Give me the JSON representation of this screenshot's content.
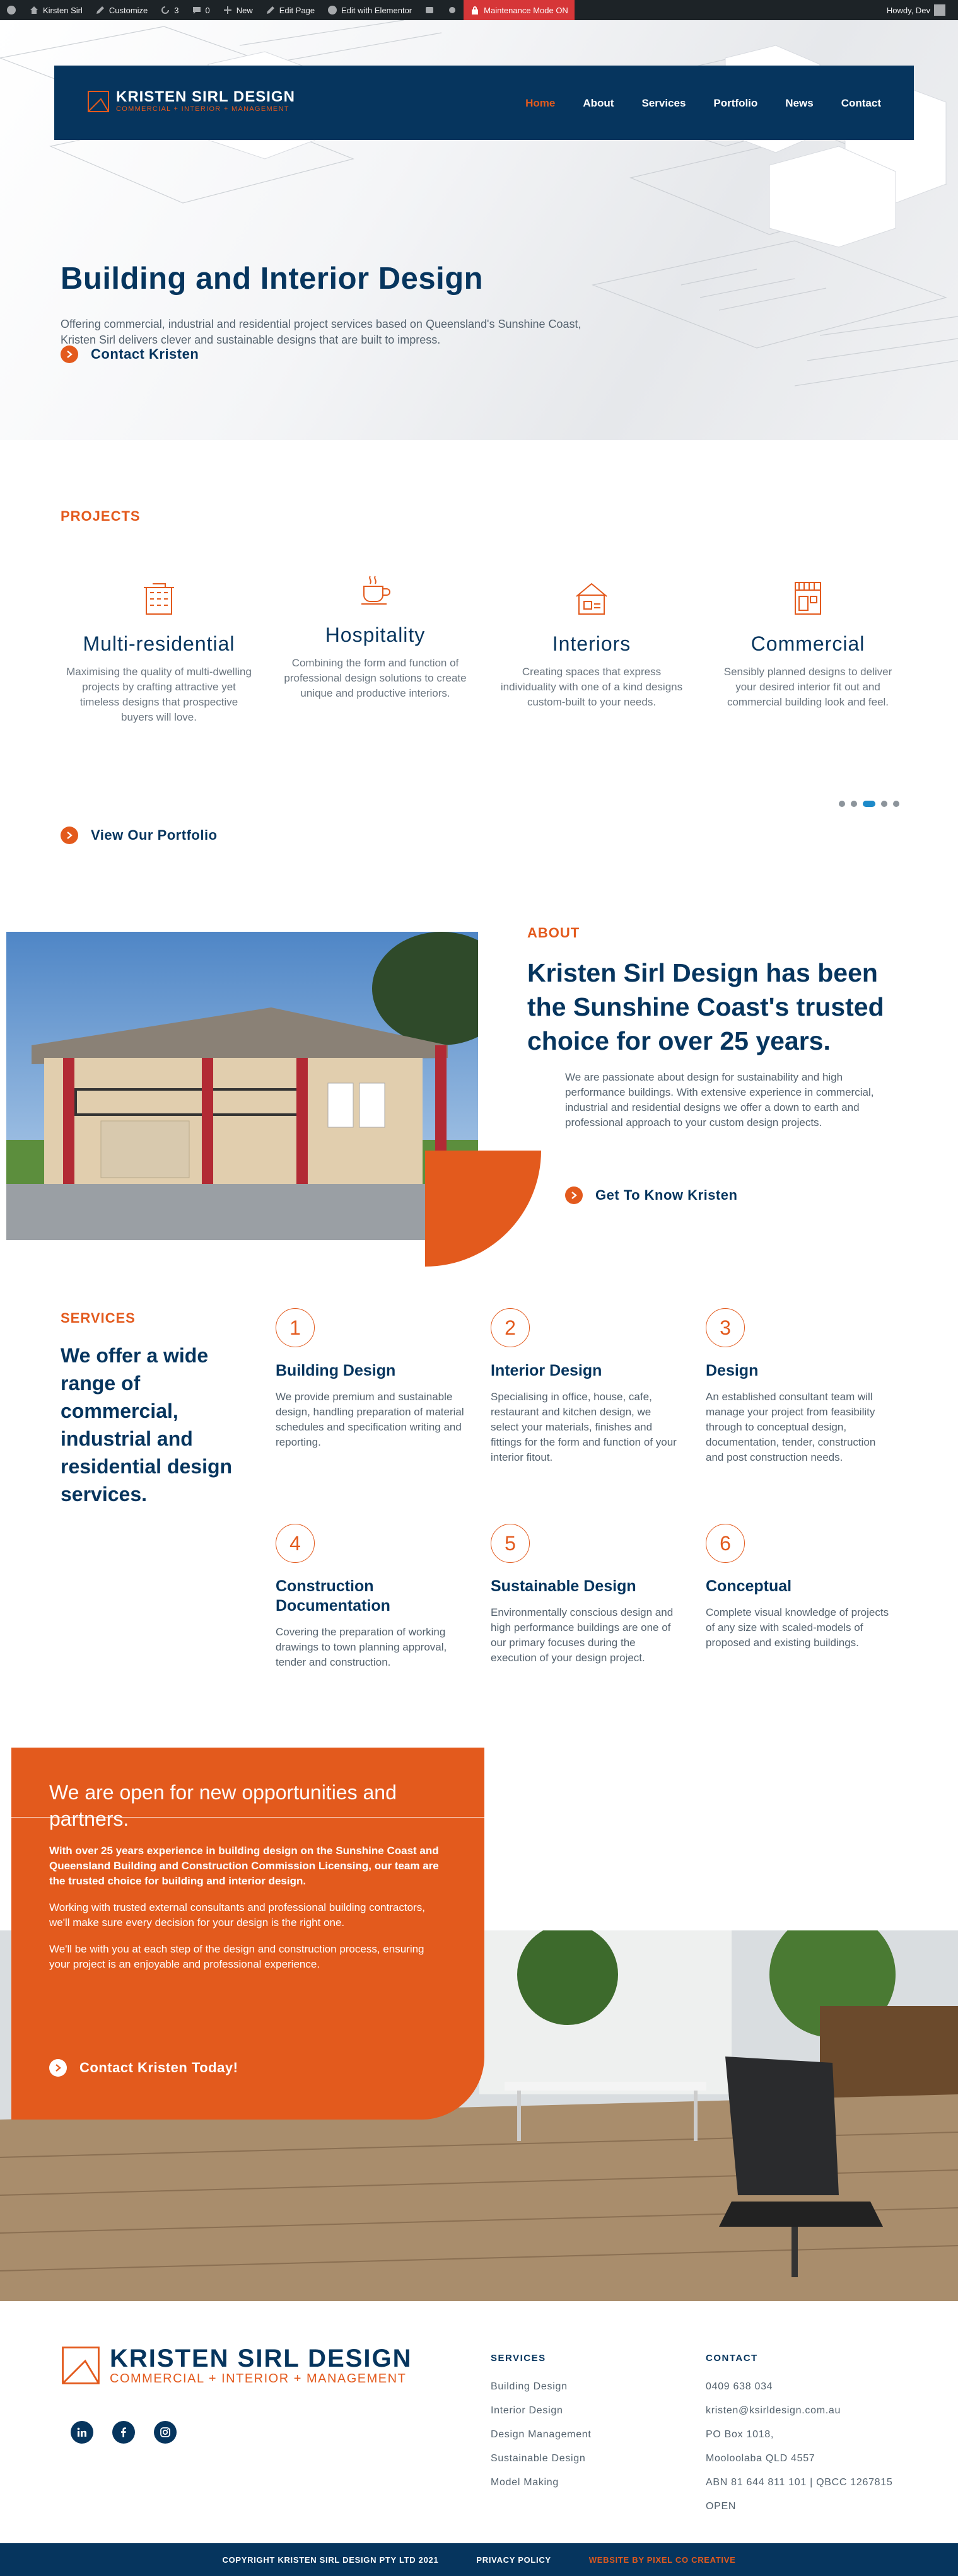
{
  "adminbar": {
    "site": "Kirsten Sirl",
    "customize": "Customize",
    "updates": "3",
    "comments": "0",
    "new": "New",
    "edit_page": "Edit Page",
    "elementor": "Edit with Elementor",
    "maintenance": "Maintenance Mode ON",
    "howdy": "Howdy, Dev"
  },
  "nav": {
    "brand": "KRISTEN SIRL DESIGN",
    "tagline": "COMMERCIAL + INTERIOR + MANAGEMENT",
    "items": [
      "Home",
      "About",
      "Services",
      "Portfolio",
      "News",
      "Contact"
    ]
  },
  "hero": {
    "title": "Building and Interior Design",
    "lead": "Offering commercial, industrial and residential project services based on Queensland's Sunshine Coast, Kristen Sirl delivers clever and sustainable designs that are built to impress.",
    "cta": "Contact Kristen"
  },
  "projects": {
    "label": "PROJECTS",
    "cards": [
      {
        "title": "Multi-residential",
        "text": "Maximising the quality of multi-dwelling projects by crafting attractive yet timeless designs that prospective buyers will love."
      },
      {
        "title": "Hospitality",
        "text": "Combining the form and function of professional design solutions to create unique and productive interiors."
      },
      {
        "title": "Interiors",
        "text": "Creating spaces that express individuality with one of a kind designs custom-built to your needs."
      },
      {
        "title": "Commercial",
        "text": "Sensibly planned designs to deliver your desired interior fit out and commercial building look and feel."
      }
    ],
    "cta": "View Our Portfolio"
  },
  "about": {
    "label": "ABOUT",
    "heading": "Kristen Sirl Design has been the Sunshine Coast's trusted choice for over 25 years.",
    "text": "We are passionate about design for sustainability and high performance buildings. With extensive experience in commercial, industrial and residential designs we offer a down to earth and professional approach to your custom design projects.",
    "cta": "Get To Know Kristen"
  },
  "services": {
    "label": "SERVICES",
    "heading": "We offer a wide range of commercial, industrial and residential design services.",
    "items": [
      {
        "num": "1",
        "title": "Building Design",
        "text": "We provide premium and sustainable design, handling preparation of material schedules and specification writing and reporting."
      },
      {
        "num": "2",
        "title": "Interior Design",
        "text": "Specialising in office, house, cafe, restaurant and kitchen design, we select your materials, finishes and fittings for the form and function of your interior fitout."
      },
      {
        "num": "3",
        "title": "Design",
        "text": "An established consultant team will manage your project from feasibility through to conceptual design, documentation, tender, construction and post construction needs."
      },
      {
        "num": "4",
        "title": "Construction Documentation",
        "text": "Covering the preparation of working drawings to town planning approval, tender and construction."
      },
      {
        "num": "5",
        "title": "Sustainable Design",
        "text": "Environmentally conscious design and high performance buildings are one of our primary focuses during the execution of your design project."
      },
      {
        "num": "6",
        "title": "Conceptual",
        "text": "Complete visual knowledge of projects of any size with scaled-models of proposed and existing buildings."
      }
    ]
  },
  "open": {
    "heading": "We are open for new opportunities and partners.",
    "bold": "With over 25 years experience in building design on the Sunshine Coast and Queensland Building and Construction Commission Licensing, our team are the trusted choice for building and interior design.",
    "p1": "Working with trusted external consultants and professional building contractors, we'll make sure every decision for your design is the right one.",
    "p2": "We'll be with you at each step of the design and construction process, ensuring your project is an enjoyable and professional experience.",
    "cta": "Contact Kristen Today!"
  },
  "footer": {
    "brand": "KRISTEN SIRL DESIGN",
    "tagline": "COMMERCIAL + INTERIOR + MANAGEMENT",
    "services_title": "SERVICES",
    "services": [
      "Building Design",
      "Interior Design",
      "Design Management",
      "Sustainable Design",
      "Model Making"
    ],
    "contact_title": "CONTACT",
    "contact": [
      "0409 638 034",
      "kristen@ksirldesign.com.au",
      "PO Box 1018,",
      "Mooloolaba QLD 4557",
      "ABN 81 644 811 101 | QBCC 1267815",
      "OPEN"
    ],
    "copyright": "COPYRIGHT KRISTEN SIRL DESIGN PTY LTD 2021",
    "privacy": "PRIVACY POLICY",
    "credit": "WEBSITE BY PIXEL CO CREATIVE"
  },
  "colors": {
    "navy": "#06355e",
    "orange": "#e35a1d"
  }
}
